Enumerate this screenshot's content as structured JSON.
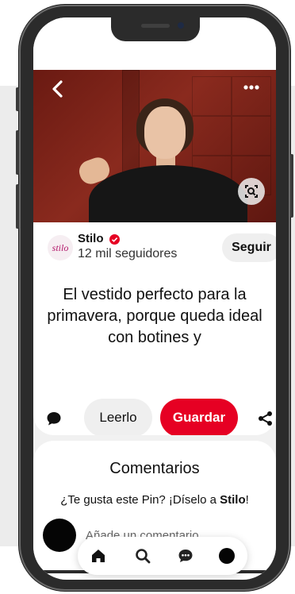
{
  "pin": {
    "author": {
      "logo_text": "stilo",
      "name": "Stilo",
      "followers": "12 mil seguidores",
      "follow_label": "Seguir"
    },
    "title": "El vestido perfecto para la primavera, porque queda ideal con botines y"
  },
  "actions": {
    "read_label": "Leerlo",
    "save_label": "Guardar"
  },
  "comments": {
    "title": "Comentarios",
    "prompt_prefix": "¿Te gusta este Pin? ¡Díselo a ",
    "prompt_name": "Stilo",
    "prompt_suffix": "!",
    "input_placeholder": "Añade un comentario"
  },
  "nav": {
    "items": [
      "home-icon",
      "search-icon",
      "messages-icon",
      "profile-avatar"
    ]
  },
  "colors": {
    "accent": "#e60023",
    "hero_bg": "#7a2318"
  }
}
